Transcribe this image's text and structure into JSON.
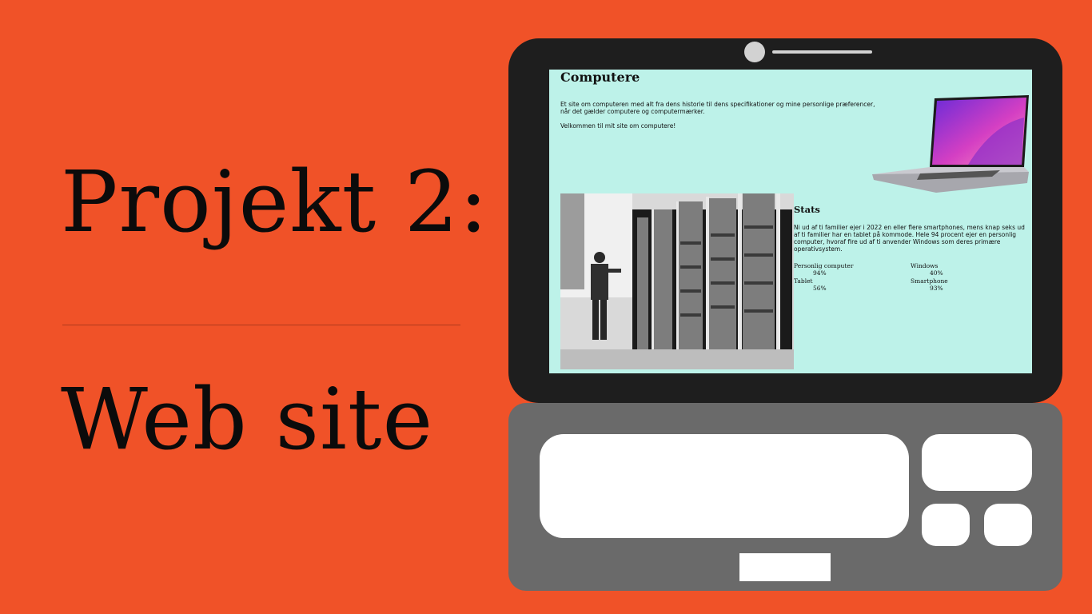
{
  "slide": {
    "title_line1": "Projekt 2:",
    "title_line2": "Web site",
    "background_color": "#f05228"
  },
  "website": {
    "title": "Computere",
    "intro": "Et site om computeren med alt fra dens historie til dens specifikationer og mine personlige præferencer, når det gælder computere og computermærker.",
    "welcome": "Velkommen til mit site om computere!",
    "stats": {
      "title": "Stats",
      "text": "Ni ud af ti familier ejer i 2022 en eller flere smartphones, mens knap seks ud af ti familier har en tablet på kommode. Hele 94 procent ejer en personlig computer, hvoraf fire ud af ti anvender Windows som deres primære operativsystem.",
      "items": [
        {
          "label": "Personlig computer",
          "value": "94%"
        },
        {
          "label": "Windows",
          "value": "40%"
        },
        {
          "label": "Tablet",
          "value": "56%"
        },
        {
          "label": "Smartphone",
          "value": "93%"
        }
      ]
    },
    "background_color": "#bdf2e9"
  },
  "icons": {
    "hero_image": "laptop-image",
    "photo": "mainframe-computer-photo"
  }
}
